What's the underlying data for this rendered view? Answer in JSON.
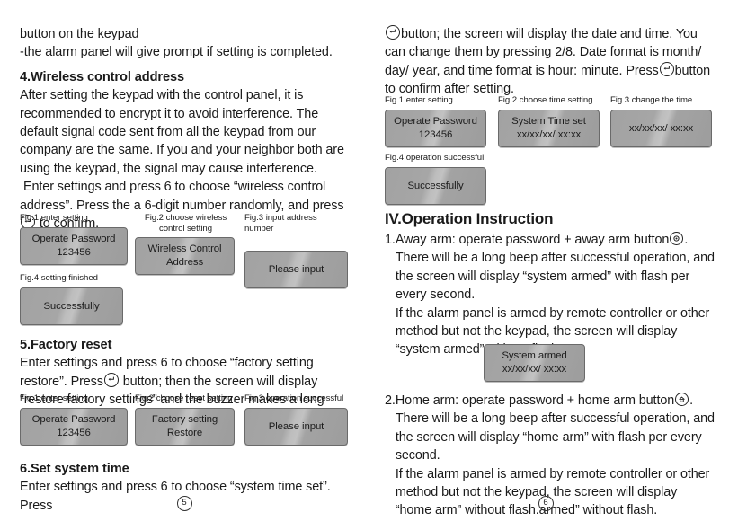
{
  "document": {
    "left_page_number": "5",
    "right_page_number": "6"
  },
  "left_column": {
    "intro_line_1": "button on the keypad",
    "intro_line_2": "-the alarm panel will give prompt if setting is completed.",
    "section4": {
      "heading": "4.Wireless control address",
      "para1": "After setting the keypad with the control panel, it is recommended to encrypt it to avoid interference. The default signal code sent from all the keypad from our company are the same. If you and your neighbor both are using the keypad, the signal may cause interference.",
      "para2_before": "Enter settings and press 6 to choose “wireless control address”. Press the a 6-digit number randomly, and press",
      "para2_after": "to confirm.",
      "figures": [
        {
          "caption": "Fig.1 enter setting",
          "line1": "Operate Password",
          "line2": "123456"
        },
        {
          "caption": "Fig.2 choose wireless control setting",
          "line1": "Wireless Control",
          "line2": "Address"
        },
        {
          "caption": "Fig.3 input address number",
          "line1": "Please input",
          "line2": ""
        },
        {
          "caption": "Fig.4 setting finished",
          "line1": "Successfully",
          "line2": ""
        }
      ]
    },
    "section5": {
      "heading": "5.Factory reset",
      "para_before": "Enter settings and press 6 to choose “factory setting restore”. Press",
      "para_after": "button; then the screen will display “restore factory settings” and the buzzer makes a long beep.",
      "figures": [
        {
          "caption": "Fig.1  enter setting",
          "line1": "Operate Password",
          "line2": "123456"
        },
        {
          "caption": "Fig.2 choose reset setting",
          "line1": "Factory setting",
          "line2": "Restore"
        },
        {
          "caption": "Fig.3 operation successful",
          "line1": "Please input",
          "line2": ""
        }
      ]
    },
    "section6": {
      "heading": "6.Set system time",
      "para": "Enter settings and press 6 to choose “system time set”. Press"
    }
  },
  "right_column": {
    "section6_cont": {
      "para_before": "",
      "para_after": "button; the screen will display the date and time. You can change them by pressing 2/8. Date format is month/ day/ year, and time format is hour: minute. Press",
      "para_tail": "button to confirm after setting.",
      "figures": [
        {
          "caption": "Fig.1  enter setting",
          "line1": "Operate Password",
          "line2": "123456"
        },
        {
          "caption": "Fig.2 choose time setting",
          "line1": "System Time set",
          "line2": "xx/xx/xx/  xx:xx"
        },
        {
          "caption": "Fig.3 change the time",
          "line1": "xx/xx/xx/  xx:xx",
          "line2": ""
        },
        {
          "caption": "Fig.4 operation successful",
          "line1": "Successfully",
          "line2": ""
        }
      ]
    },
    "section_operation": {
      "heading": "IV.Operation Instruction",
      "item1": {
        "number": "1.",
        "text_before": "Away arm: operate password + away arm button",
        "text_after": ". There will be a long beep after successful operation, and the screen will display “system armed” with flash per every second.",
        "text_extra": "If the alarm panel is armed by remote controller or other method but not the keypad, the screen will display “system armed” without flash."
      },
      "figure_armed": {
        "line1": "System armed",
        "line2": "xx/xx/xx/  xx:xx"
      },
      "item2": {
        "number": "2.",
        "text_before": "Home arm: operate password + home arm button",
        "text_after": ". There will be a long beep after successful operation, and the screen will display “home arm” with flash per every second.",
        "text_extra": "If the alarm panel is armed by remote controller or other method but not the keypad, the screen will display “home arm” without flash.armed” without flash."
      }
    }
  }
}
